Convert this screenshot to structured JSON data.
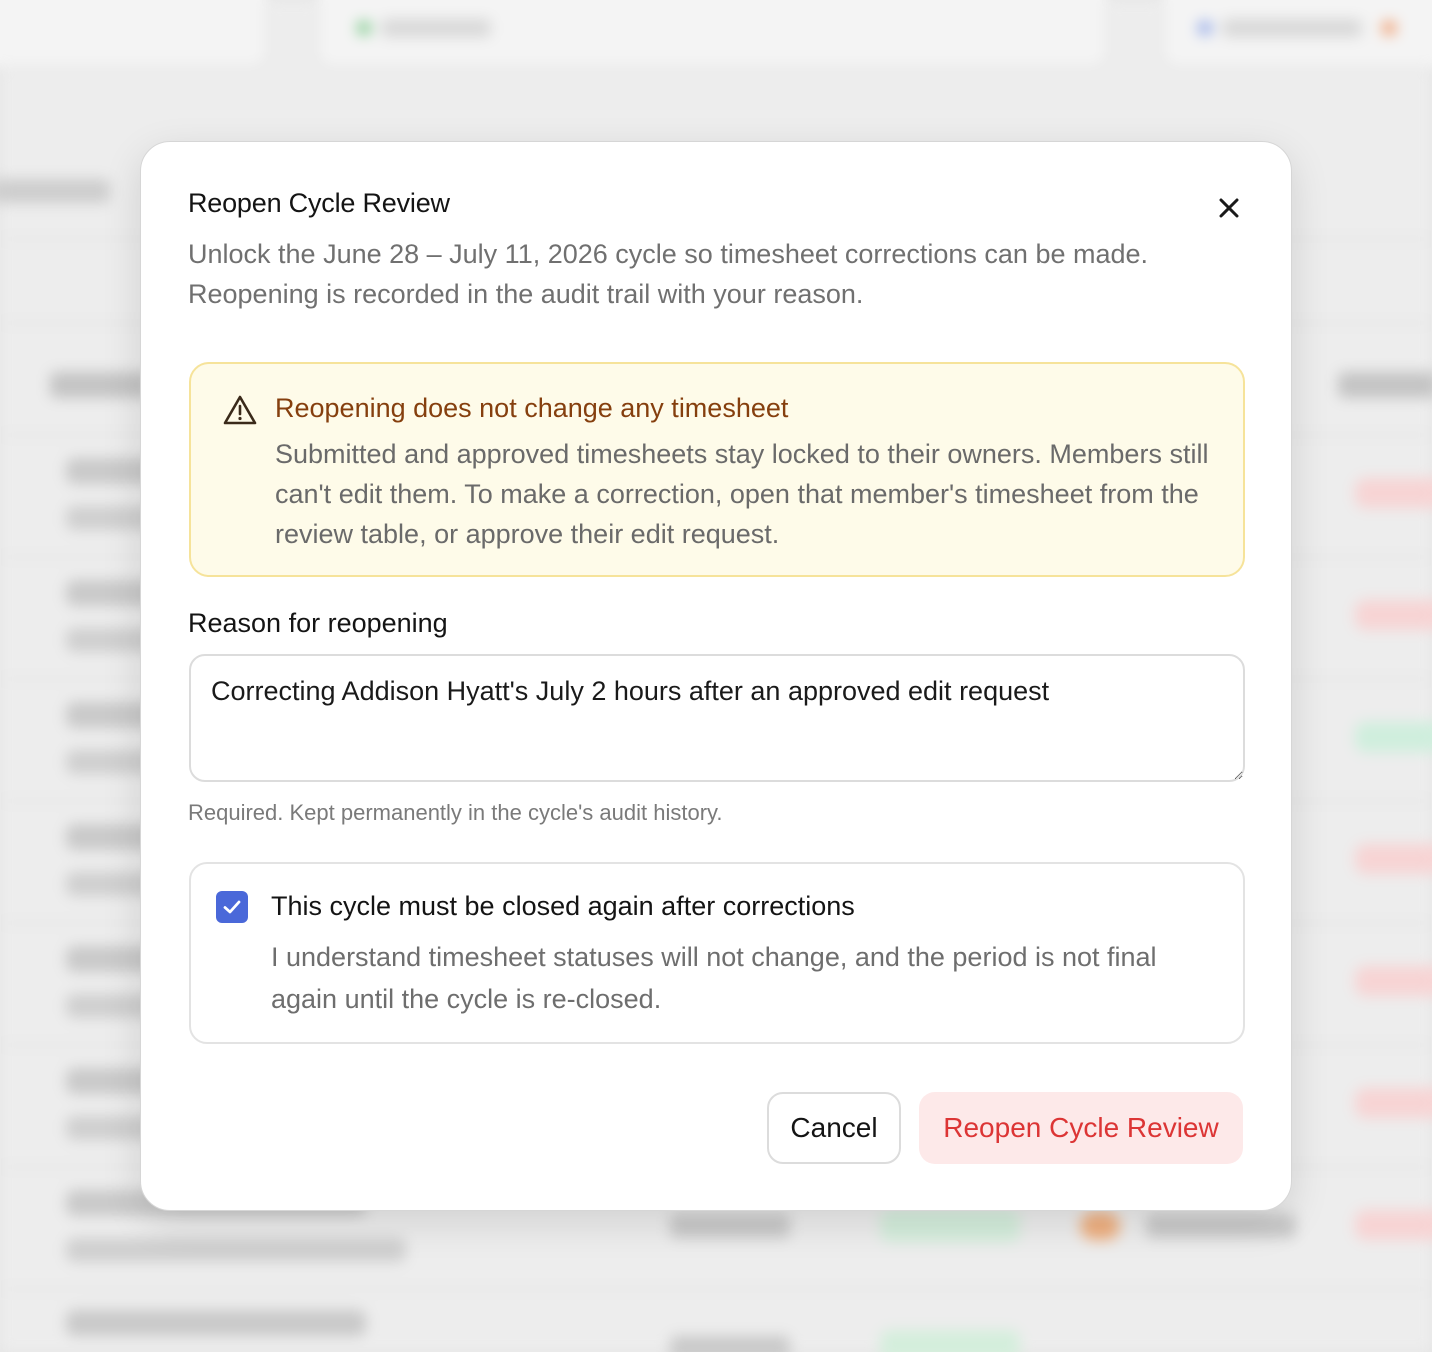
{
  "modal": {
    "title": "Reopen Cycle Review",
    "description": "Unlock the June 28 – July 11, 2026 cycle so timesheet corrections can be made. Reopening is recorded in the audit trail with your reason.",
    "close_icon": "close-icon"
  },
  "warning": {
    "icon": "warning-triangle-icon",
    "title": "Reopening does not change any timesheet",
    "body": "Submitted and approved timesheets stay locked to their owners. Members still can't edit them. To make a correction, open that member's timesheet from the review table, or approve their edit request."
  },
  "reason": {
    "label": "Reason for reopening",
    "value": "Correcting Addison Hyatt's July 2 hours after an approved edit request",
    "hint": "Required. Kept permanently in the cycle's audit history."
  },
  "confirmation": {
    "checked": true,
    "title": "This cycle must be closed again after corrections",
    "body": "I understand timesheet statuses will not change, and the period is not final again until the cycle is re-closed."
  },
  "actions": {
    "cancel_label": "Cancel",
    "reopen_label": "Reopen Cycle Review"
  },
  "colors": {
    "primary_checkbox": "#4a68d9",
    "danger_text": "#dc3535",
    "danger_bg": "#fde9e9",
    "warning_bg": "#fefbe9",
    "warning_border": "#f6e39a",
    "warning_title": "#853f0e"
  }
}
